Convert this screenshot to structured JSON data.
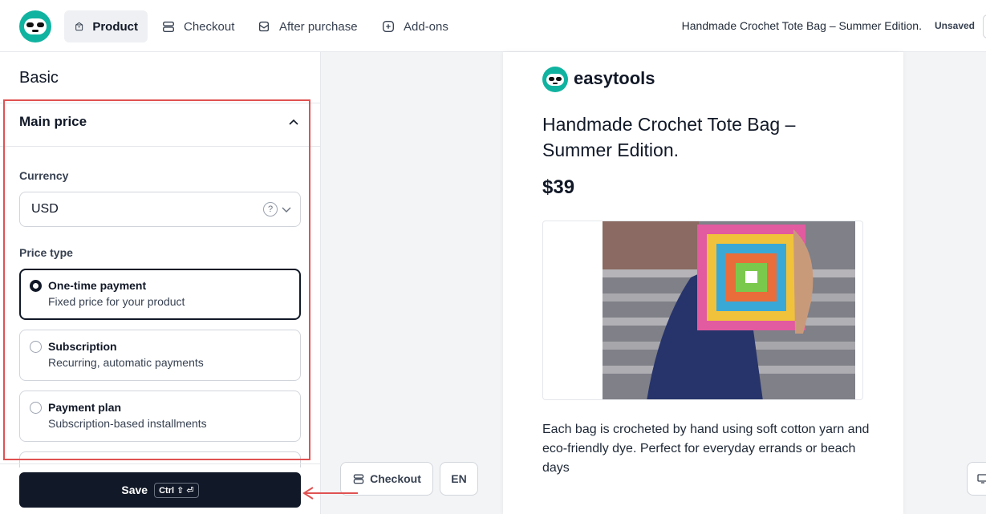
{
  "header": {
    "tabs": [
      {
        "label": "Product",
        "icon": "box-icon",
        "active": true
      },
      {
        "label": "Checkout",
        "icon": "checkout-icon",
        "active": false
      },
      {
        "label": "After purchase",
        "icon": "mailbox-icon",
        "active": false
      },
      {
        "label": "Add-ons",
        "icon": "plus-square-icon",
        "active": false
      }
    ],
    "document_title": "Handmade Crochet Tote Bag – Summer Edition.",
    "status": "Unsaved"
  },
  "sidebar": {
    "section_title": "Basic",
    "panel_title": "Main price",
    "currency_label": "Currency",
    "currency_value": "USD",
    "price_type_label": "Price type",
    "options": [
      {
        "title": "One-time payment",
        "description": "Fixed price for your product",
        "selected": true
      },
      {
        "title": "Subscription",
        "description": "Recurring, automatic payments",
        "selected": false
      },
      {
        "title": "Payment plan",
        "description": "Subscription-based installments",
        "selected": false
      }
    ],
    "save_label": "Save",
    "save_shortcut": "Ctrl ⇧ ⏎"
  },
  "preview": {
    "brand": "easytools",
    "product_title": "Handmade Crochet Tote Bag – Summer Edition.",
    "price": "$39",
    "description": "Each bag is crocheted by hand using soft cotton yarn and eco-friendly dye. Perfect for everyday errands or beach days",
    "checkout_button": "Checkout",
    "language_button": "EN"
  },
  "colors": {
    "brand_teal": "#10b3a0",
    "primary_dark": "#111827",
    "highlight_red": "#e05252"
  }
}
